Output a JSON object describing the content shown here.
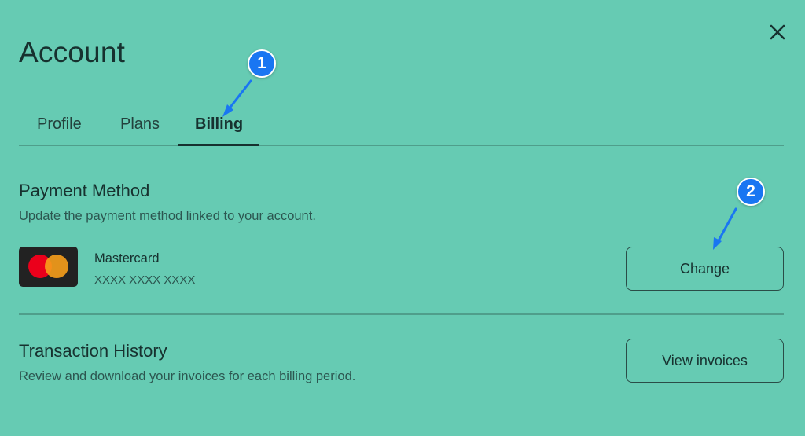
{
  "page": {
    "title": "Account"
  },
  "tabs": [
    {
      "label": "Profile",
      "active": false
    },
    {
      "label": "Plans",
      "active": false
    },
    {
      "label": "Billing",
      "active": true
    }
  ],
  "payment_method": {
    "heading": "Payment Method",
    "description": "Update the payment method linked to your account.",
    "card_brand": "Mastercard",
    "card_number": "XXXX XXXX XXXX",
    "change_label": "Change"
  },
  "transaction_history": {
    "heading": "Transaction History",
    "description": "Review and download your invoices for each billing period.",
    "view_invoices_label": "View invoices"
  },
  "annotations": [
    {
      "number": "1"
    },
    {
      "number": "2"
    }
  ],
  "colors": {
    "background": "#66cbb3",
    "text_dark": "#17312f",
    "annotation_blue": "#1976f2",
    "mastercard_red": "#eb001b",
    "mastercard_orange": "#f79e1b"
  }
}
